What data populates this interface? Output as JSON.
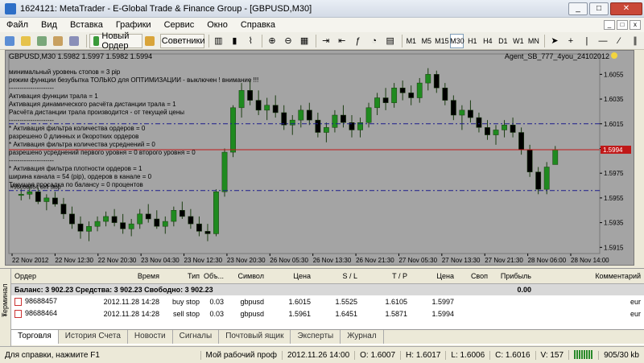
{
  "window": {
    "title": "1624121: MetaTrader - E-Global Trade & Finance Group - [GBPUSD,M30]",
    "minimize": "_",
    "maximize": "□",
    "close": "✕"
  },
  "menu": [
    "Файл",
    "Вид",
    "Вставка",
    "Графики",
    "Сервис",
    "Окно",
    "Справка"
  ],
  "toolbar": {
    "new_order_label": "Новый Ордер",
    "advisors_label": "Советники",
    "timeframes": [
      "M1",
      "M5",
      "M15",
      "M30",
      "H1",
      "H4",
      "D1",
      "W1",
      "MN"
    ],
    "selected_timeframe": "M30"
  },
  "chart": {
    "symbol_header": "GBPUSD,M30  1.5982 1.5997 1.5982 1.5994",
    "ea_label": "Agent_SB_777_4you_24102012",
    "info_lines": [
      "минимальный уровень стопов =  3 pip",
      "режим функции безубытка ТОЛЬКО для ОПТИМИЗАЦИИ - выключен ! внимание !!!",
      "---------------------",
      "Активация функции трала =  1",
      "Активация динамического расчёта дистанции трала =  1",
      "Расчёта дистанции трала производится - от текущей цены",
      "---------------------",
      "* Активация фильтра количества ордеров =  0",
      "разрешено 0 длинных и 0коротких ордеров",
      "* Активация фильтра количества усреднений =  0",
      "разрешено усреднений первого уровня =  0 второго уровня =  0",
      "---------------------",
      "* Активация фильтра плотности ордеров =  1",
      "ширина канала = 54 (pip), ордеров в канале =  0",
      "Текущая просадка по балансу =  0 процентов"
    ],
    "left_label": "#98688464 sell stop",
    "price_labels": [
      "1.6055",
      "1.6035",
      "1.6015",
      "1.5995",
      "1.5975",
      "1.5955",
      "1.5935",
      "1.5915"
    ],
    "current_price": "1.5994",
    "time_labels": [
      "22 Nov 2012",
      "22 Nov 12:30",
      "22 Nov 20:30",
      "23 Nov 04:30",
      "23 Nov 12:30",
      "23 Nov 20:30",
      "26 Nov 05:30",
      "26 Nov 13:30",
      "26 Nov 21:30",
      "27 Nov 05:30",
      "27 Nov 13:30",
      "27 Nov 21:30",
      "28 Nov 06:00",
      "28 Nov 14:00"
    ]
  },
  "chart_data": {
    "type": "candlestick",
    "symbol": "GBPUSD",
    "timeframe": "M30",
    "ylim": [
      1.591,
      1.6065
    ],
    "ohlc": [
      [
        1.5957,
        1.5962,
        1.5953,
        1.5958
      ],
      [
        1.5958,
        1.5964,
        1.5954,
        1.596
      ],
      [
        1.596,
        1.5963,
        1.595,
        1.5952
      ],
      [
        1.5952,
        1.5958,
        1.5945,
        1.5955
      ],
      [
        1.5955,
        1.596,
        1.5948,
        1.595
      ],
      [
        1.595,
        1.5955,
        1.5938,
        1.5942
      ],
      [
        1.5942,
        1.5948,
        1.593,
        1.5934
      ],
      [
        1.5934,
        1.594,
        1.5922,
        1.5928
      ],
      [
        1.5928,
        1.5936,
        1.592,
        1.5932
      ],
      [
        1.5932,
        1.594,
        1.5928,
        1.5936
      ],
      [
        1.5936,
        1.5944,
        1.5932,
        1.594
      ],
      [
        1.594,
        1.5946,
        1.5932,
        1.5935
      ],
      [
        1.5935,
        1.5942,
        1.5926,
        1.593
      ],
      [
        1.593,
        1.5938,
        1.5924,
        1.5934
      ],
      [
        1.5934,
        1.5946,
        1.593,
        1.5942
      ],
      [
        1.5942,
        1.595,
        1.5935,
        1.5938
      ],
      [
        1.5938,
        1.5945,
        1.593,
        1.5932
      ],
      [
        1.5932,
        1.594,
        1.5926,
        1.5936
      ],
      [
        1.5936,
        1.5948,
        1.5932,
        1.5945
      ],
      [
        1.5945,
        1.5952,
        1.5938,
        1.594
      ],
      [
        1.594,
        1.5946,
        1.593,
        1.5934
      ],
      [
        1.5934,
        1.594,
        1.5924,
        1.5928
      ],
      [
        1.5928,
        1.5934,
        1.592,
        1.5926
      ],
      [
        1.5926,
        1.5962,
        1.5924,
        1.596
      ],
      [
        1.596,
        1.5995,
        1.5956,
        1.5992
      ],
      [
        1.5992,
        1.603,
        1.5988,
        1.6028
      ],
      [
        1.6028,
        1.6048,
        1.602,
        1.6042
      ],
      [
        1.6042,
        1.605,
        1.603,
        1.6034
      ],
      [
        1.6034,
        1.6042,
        1.6022,
        1.6026
      ],
      [
        1.6026,
        1.6036,
        1.6018,
        1.603
      ],
      [
        1.603,
        1.6038,
        1.602,
        1.6024
      ],
      [
        1.6024,
        1.603,
        1.601,
        1.6014
      ],
      [
        1.6014,
        1.6022,
        1.6006,
        1.6018
      ],
      [
        1.6018,
        1.603,
        1.6012,
        1.6026
      ],
      [
        1.6026,
        1.6032,
        1.6014,
        1.6018
      ],
      [
        1.6018,
        1.6024,
        1.6004,
        1.6008
      ],
      [
        1.6008,
        1.6016,
        1.6,
        1.6012
      ],
      [
        1.6012,
        1.6026,
        1.6008,
        1.6022
      ],
      [
        1.6022,
        1.603,
        1.6012,
        1.6016
      ],
      [
        1.6016,
        1.6022,
        1.6004,
        1.601
      ],
      [
        1.601,
        1.602,
        1.6004,
        1.6016
      ],
      [
        1.6016,
        1.6032,
        1.6012,
        1.6028
      ],
      [
        1.6028,
        1.604,
        1.6022,
        1.6036
      ],
      [
        1.6036,
        1.6044,
        1.6026,
        1.6032
      ],
      [
        1.6032,
        1.6048,
        1.6028,
        1.6044
      ],
      [
        1.6044,
        1.605,
        1.6034,
        1.604
      ],
      [
        1.604,
        1.6046,
        1.603,
        1.6036
      ],
      [
        1.6036,
        1.6052,
        1.6032,
        1.6048
      ],
      [
        1.6048,
        1.606,
        1.6042,
        1.6055
      ],
      [
        1.6055,
        1.6058,
        1.604,
        1.6044
      ],
      [
        1.6044,
        1.6048,
        1.603,
        1.6034
      ],
      [
        1.6034,
        1.6038,
        1.6018,
        1.6022
      ],
      [
        1.6022,
        1.603,
        1.601,
        1.6026
      ],
      [
        1.6026,
        1.6034,
        1.6016,
        1.602
      ],
      [
        1.602,
        1.6024,
        1.6008,
        1.6012
      ],
      [
        1.6012,
        1.6018,
        1.6002,
        1.6006
      ],
      [
        1.6006,
        1.6014,
        1.5998,
        1.601
      ],
      [
        1.601,
        1.6018,
        1.6004,
        1.6014
      ],
      [
        1.6014,
        1.602,
        1.6004,
        1.6008
      ],
      [
        1.6008,
        1.6012,
        1.599,
        1.5994
      ],
      [
        1.5994,
        1.5998,
        1.5972,
        1.5976
      ],
      [
        1.5976,
        1.598,
        1.5958,
        1.5962
      ],
      [
        1.5962,
        1.5984,
        1.5958,
        1.598
      ],
      [
        1.5982,
        1.5997,
        1.5982,
        1.5994
      ]
    ],
    "levels": [
      {
        "name": "buy stop 98688457",
        "price": 1.6015,
        "color": "#1d1d8c"
      },
      {
        "name": "sell stop 98688464",
        "price": 1.5961,
        "color": "#1d1d8c"
      },
      {
        "name": "bid",
        "price": 1.5994,
        "color": "#c01818"
      }
    ]
  },
  "terminal": {
    "side_title": "Терминал",
    "columns": [
      "Ордер",
      "Время",
      "Тип",
      "Объ...",
      "Символ",
      "Цена",
      "S / L",
      "T / P",
      "Цена",
      "Своп",
      "Прибыль",
      "Комментарий"
    ],
    "balance_text": "Баланс: 3 902.23  Средства: 3 902.23  Свободно: 3 902.23",
    "balance_profit": "0.00",
    "rows": [
      {
        "order": "98688457",
        "time": "2012.11.28 14:28",
        "type": "buy stop",
        "volume": "0.03",
        "symbol": "gbpusd",
        "price": "1.6015",
        "sl": "1.5525",
        "tp": "1.6105",
        "cur_price": "1.5997",
        "swap": "",
        "profit": "",
        "comment": "eur"
      },
      {
        "order": "98688464",
        "time": "2012.11.28 14:28",
        "type": "sell stop",
        "volume": "0.03",
        "symbol": "gbpusd",
        "price": "1.5961",
        "sl": "1.6451",
        "tp": "1.5871",
        "cur_price": "1.5994",
        "swap": "",
        "profit": "",
        "comment": "eur"
      }
    ],
    "tabs": [
      "Торговля",
      "История Счета",
      "Новости",
      "Сигналы",
      "Почтовый ящик",
      "Эксперты",
      "Журнал"
    ],
    "active_tab": "Торговля"
  },
  "status": {
    "help": "Для справки, нажмите F1",
    "profile": "Мой рабочий проф",
    "datetime": "2012.11.26 14:00",
    "open": "O: 1.6007",
    "high": "H: 1.6017",
    "low": "L: 1.6006",
    "close": "C: 1.6016",
    "volume": "V: 157",
    "traffic": "905/30 kb"
  }
}
